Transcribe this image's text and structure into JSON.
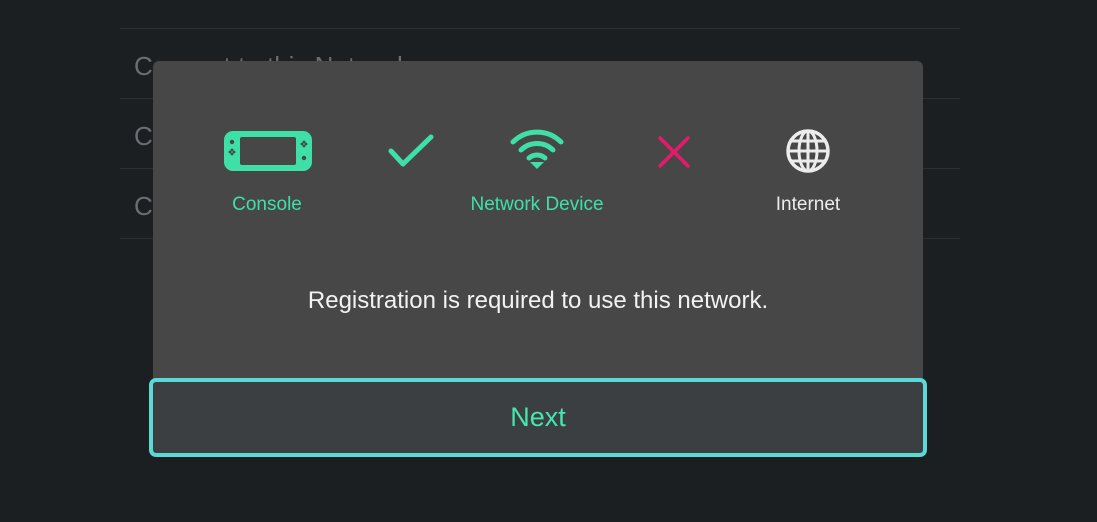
{
  "background": {
    "rows": [
      "Connect to this Network",
      "C",
      "C"
    ]
  },
  "dialog": {
    "status": {
      "console": {
        "label": "Console",
        "icon": "console-icon"
      },
      "link1": {
        "icon": "check-icon",
        "state": "success"
      },
      "network_device": {
        "label": "Network Device",
        "icon": "wifi-icon"
      },
      "link2": {
        "icon": "cross-icon",
        "state": "failure"
      },
      "internet": {
        "label": "Internet",
        "icon": "globe-icon"
      }
    },
    "message": "Registration is required to use this network.",
    "next_label": "Next"
  },
  "colors": {
    "accent_green": "#3ee0a8",
    "error_pink": "#e8196b",
    "button_border": "#5ad9d6",
    "dialog_bg": "#474747",
    "page_bg": "#1c1f22"
  }
}
